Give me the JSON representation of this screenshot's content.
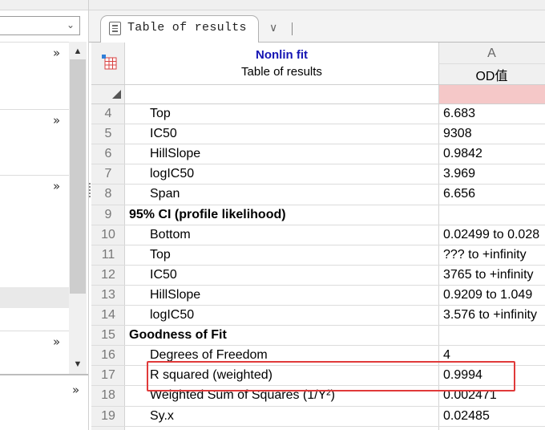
{
  "tab": {
    "label": "Table of results"
  },
  "sheet": {
    "analysis_name": "Nonlin fit",
    "analysis_subtitle": "Table of results",
    "column_letter": "A",
    "column_title": "OD值"
  },
  "rows": [
    {
      "num": "4",
      "label": "Top",
      "value": "6.683",
      "header": false
    },
    {
      "num": "5",
      "label": "IC50",
      "value": "9308",
      "header": false
    },
    {
      "num": "6",
      "label": "HillSlope",
      "value": "0.9842",
      "header": false
    },
    {
      "num": "7",
      "label": "logIC50",
      "value": "3.969",
      "header": false
    },
    {
      "num": "8",
      "label": "Span",
      "value": "6.656",
      "header": false
    },
    {
      "num": "9",
      "label": "95% CI (profile likelihood)",
      "value": "",
      "header": true
    },
    {
      "num": "10",
      "label": "Bottom",
      "value": "0.02499 to 0.028",
      "header": false
    },
    {
      "num": "11",
      "label": "Top",
      "value": "??? to +infinity",
      "header": false
    },
    {
      "num": "12",
      "label": "IC50",
      "value": "3765 to +infinity",
      "header": false
    },
    {
      "num": "13",
      "label": "HillSlope",
      "value": "0.9209 to 1.049",
      "header": false
    },
    {
      "num": "14",
      "label": "logIC50",
      "value": "3.576 to +infinity",
      "header": false
    },
    {
      "num": "15",
      "label": "Goodness of Fit",
      "value": "",
      "header": true
    },
    {
      "num": "16",
      "label": "Degrees of Freedom",
      "value": "4",
      "header": false
    },
    {
      "num": "17",
      "label": "R squared (weighted)",
      "value": "0.9994",
      "header": false
    },
    {
      "num": "18",
      "label": "Weighted Sum of Squares (1/Y²)",
      "value": "0.002471",
      "header": false
    },
    {
      "num": "19",
      "label": "Sy.x",
      "value": "0.02485",
      "header": false
    }
  ],
  "icons": {
    "nav_expand": "double-chevron-right-icon",
    "dropdown": "chevron-down-icon",
    "scroll_up": "scroll-up-arrow-icon",
    "scroll_down": "scroll-down-arrow-icon",
    "tab_doc": "document-icon",
    "tab_menu": "chevron-down-icon",
    "sheet": "results-sheet-icon"
  },
  "glyphs": {
    "nav_expand": "»",
    "dropdown": "⌄",
    "scroll_up": "▲",
    "scroll_down": "▼",
    "tab_menu": "∨"
  },
  "colors": {
    "analysis_title": "#1515b4",
    "highlight_box": "#e03a3a",
    "selected_cell": "#f5c8c8"
  }
}
